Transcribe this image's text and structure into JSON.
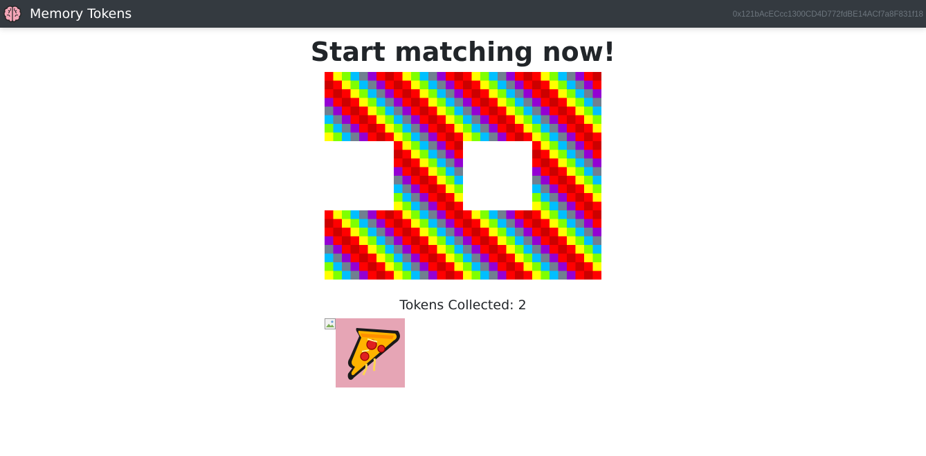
{
  "navbar": {
    "brand_title": "Memory Tokens",
    "brand_icon": "brain-icon",
    "account": "0x121bAcECcc1300CD4D772fdBE14ACf7a8F831f18"
  },
  "main": {
    "heading": "Start matching now!",
    "tokens_collected_label": "Tokens Collected: 2",
    "tokens_collected_count": 2
  },
  "board": {
    "rows": 3,
    "cols": 4,
    "cards": [
      {
        "state": "hidden"
      },
      {
        "state": "hidden"
      },
      {
        "state": "hidden"
      },
      {
        "state": "hidden"
      },
      {
        "state": "matched"
      },
      {
        "state": "hidden"
      },
      {
        "state": "matched"
      },
      {
        "state": "hidden"
      },
      {
        "state": "hidden"
      },
      {
        "state": "hidden"
      },
      {
        "state": "hidden"
      },
      {
        "state": "hidden"
      }
    ],
    "card_back_palette": [
      "#ff0000",
      "#ffff00",
      "#7fff00",
      "#00bfff",
      "#708090",
      "#9400d3",
      "#ff0000",
      "#cc0000"
    ]
  },
  "collected_tokens": [
    {
      "kind": "broken-image",
      "icon": "broken-image-icon"
    },
    {
      "kind": "image",
      "icon": "pizza-icon",
      "background": "#e6a5b5"
    }
  ]
}
